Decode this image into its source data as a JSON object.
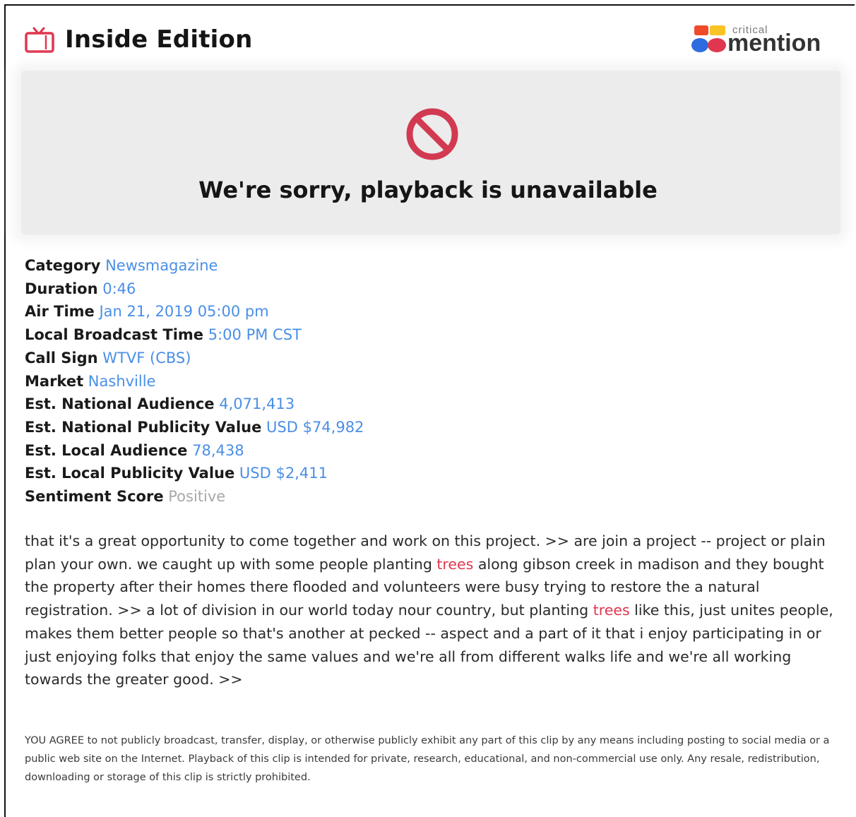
{
  "header": {
    "icon": "tv-icon",
    "title": "Inside Edition",
    "logo": {
      "small": "critical",
      "big": "mention",
      "colors": [
        "#f04a2b",
        "#f7c325",
        "#2d6be0",
        "#e0364f"
      ]
    }
  },
  "player": {
    "icon": "ban-icon",
    "message": "We're sorry, playback is unavailable"
  },
  "meta": [
    {
      "label": "Category",
      "value": "Newsmagazine"
    },
    {
      "label": "Duration",
      "value": "0:46"
    },
    {
      "label": "Air Time",
      "value": "Jan 21, 2019 05:00 pm"
    },
    {
      "label": "Local Broadcast Time",
      "value": "5:00 PM CST"
    },
    {
      "label": "Call Sign",
      "value": "WTVF (CBS)"
    },
    {
      "label": "Market",
      "value": "Nashville"
    },
    {
      "label": "Est. National Audience",
      "value": "4,071,413"
    },
    {
      "label": "Est. National Publicity Value",
      "value": "USD $74,982"
    },
    {
      "label": "Est. Local Audience",
      "value": "78,438"
    },
    {
      "label": "Est. Local Publicity Value",
      "value": "USD $2,411"
    },
    {
      "label": "Sentiment Score",
      "value": "Positive"
    }
  ],
  "transcript": {
    "part1": "that it's a great opportunity to come together and work on this project. >> are join a project -- project or plain plan your own. we caught up with some people planting ",
    "highlight1": "trees",
    "part2": " along gibson creek in madison and they bought the property after their homes there flooded and volunteers were busy trying to restore the a natural registration. >> a lot of division in our world today nour country, but planting ",
    "highlight2": "trees",
    "part3": " like this, just unites people, makes them better people so that's another at pecked -- aspect and a part of it that i enjoy participating in or just enjoying folks that enjoy the same values and we're all from different walks life and we're all working towards the greater good. >>"
  },
  "disclaimer": "YOU AGREE to not publicly broadcast, transfer, display, or otherwise publicly exhibit any part of this clip by any means including posting to social media or a public web site on the Internet. Playback of this clip is intended for private, research, educational, and non-commercial use only. Any resale, redistribution, downloading or storage of this clip is strictly prohibited."
}
